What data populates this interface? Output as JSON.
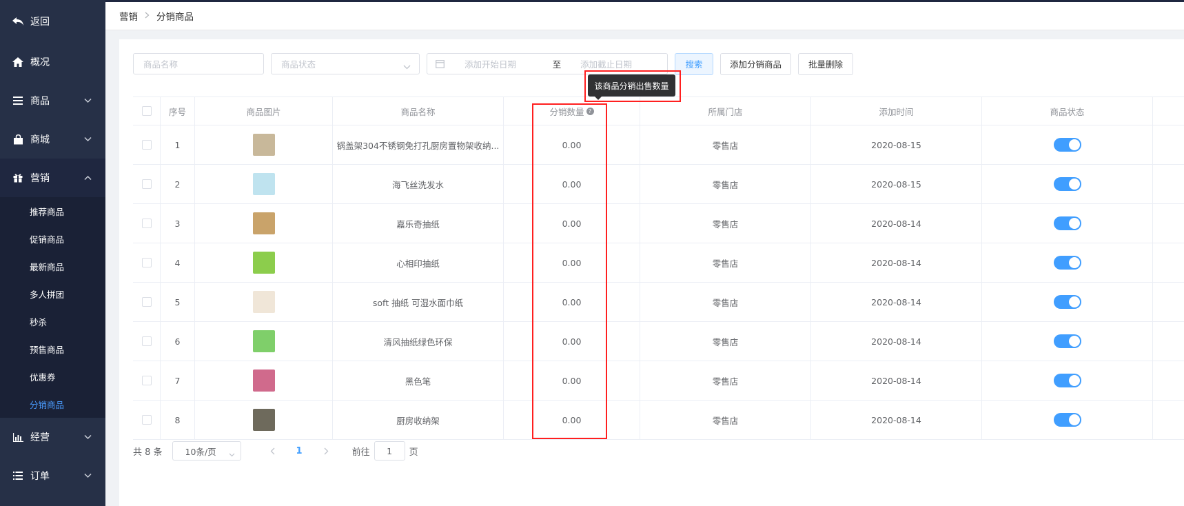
{
  "sidebar": {
    "items": [
      {
        "label": "返回",
        "icon": "back-arrow-icon"
      },
      {
        "label": "概况",
        "icon": "home-icon"
      },
      {
        "label": "商品",
        "icon": "list-icon"
      },
      {
        "label": "商城",
        "icon": "shopping-bag-icon"
      },
      {
        "label": "营销",
        "icon": "gift-icon"
      },
      {
        "label": "经营",
        "icon": "bar-chart-icon"
      },
      {
        "label": "订单",
        "icon": "list-icon"
      }
    ],
    "submenu": [
      "推荐商品",
      "促销商品",
      "最新商品",
      "多人拼团",
      "秒杀",
      "预售商品",
      "优惠券",
      "分销商品"
    ]
  },
  "breadcrumb": {
    "parent": "营销",
    "current": "分销商品"
  },
  "filters": {
    "name_placeholder": "商品名称",
    "status_placeholder": "商品状态",
    "start_date_placeholder": "添加开始日期",
    "range_sep": "至",
    "end_date_placeholder": "添加截止日期",
    "search": "搜索",
    "add": "添加分销商品",
    "batch_delete": "批量删除"
  },
  "tooltip": "该商品分销出售数量",
  "table": {
    "headers": [
      "序号",
      "商品图片",
      "商品名称",
      "分销数量",
      "所属门店",
      "添加时间",
      "商品状态"
    ],
    "rows": [
      {
        "no": "1",
        "name": "锅盖架304不锈钢免打孔厨房置物架收纳...",
        "qty": "0.00",
        "store": "零售店",
        "date": "2020-08-15",
        "status": "on",
        "thumb": "#c8b89a"
      },
      {
        "no": "2",
        "name": "海飞丝洗发水",
        "qty": "0.00",
        "store": "零售店",
        "date": "2020-08-15",
        "status": "on",
        "thumb": "#bfe3ef"
      },
      {
        "no": "3",
        "name": "嘉乐奇抽纸",
        "qty": "0.00",
        "store": "零售店",
        "date": "2020-08-14",
        "status": "on",
        "thumb": "#c9a36a"
      },
      {
        "no": "4",
        "name": "心相印抽纸",
        "qty": "0.00",
        "store": "零售店",
        "date": "2020-08-14",
        "status": "on",
        "thumb": "#8ccd4c"
      },
      {
        "no": "5",
        "name": "soft 抽纸 可湿水面巾纸",
        "qty": "0.00",
        "store": "零售店",
        "date": "2020-08-14",
        "status": "on",
        "thumb": "#f0e6d8"
      },
      {
        "no": "6",
        "name": "清风抽纸绿色环保",
        "qty": "0.00",
        "store": "零售店",
        "date": "2020-08-14",
        "status": "on",
        "thumb": "#7fcf6a"
      },
      {
        "no": "7",
        "name": "黑色笔",
        "qty": "0.00",
        "store": "零售店",
        "date": "2020-08-14",
        "status": "on",
        "thumb": "#d06a8c"
      },
      {
        "no": "8",
        "name": "厨房收纳架",
        "qty": "0.00",
        "store": "零售店",
        "date": "2020-08-14",
        "status": "on",
        "thumb": "#6e6a5c"
      }
    ]
  },
  "pagination": {
    "total": "共 8 条",
    "page_size": "10条/页",
    "current_page": "1",
    "goto_prefix": "前往",
    "goto_value": "1",
    "goto_suffix": "页"
  },
  "colors": {
    "accent": "#409eff",
    "sidebar": "#263047",
    "highlight": "#ff1f1f"
  }
}
